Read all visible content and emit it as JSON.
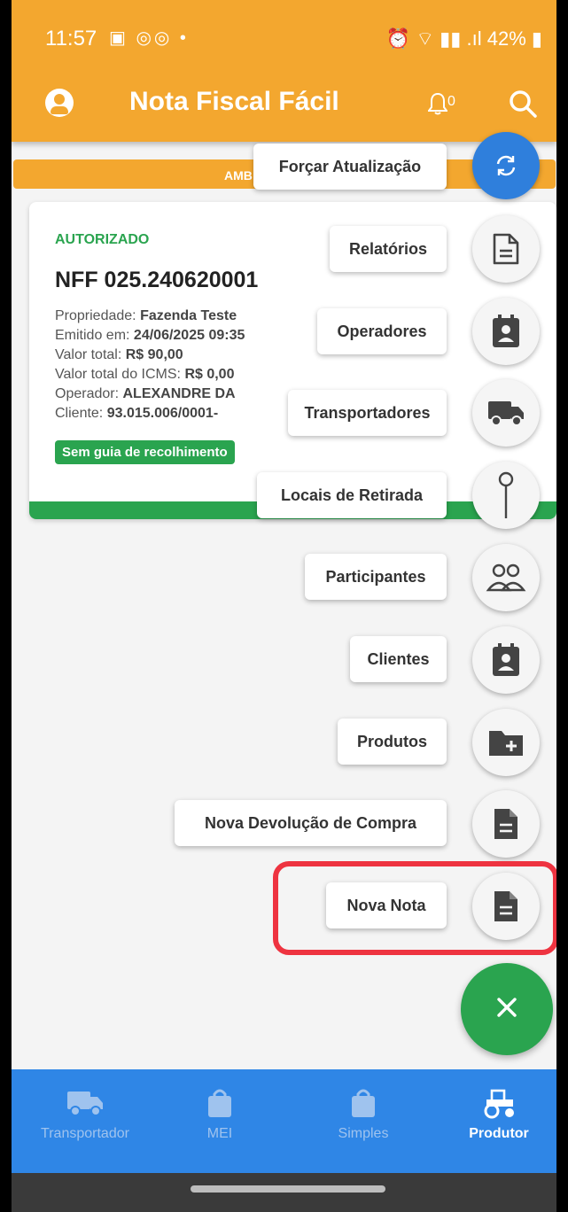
{
  "status_bar": {
    "time": "11:57",
    "left_icons": "▣ ◎◎ •",
    "right_icons": "⏰ ⌔ ▮▮ .ıl",
    "battery": "42%"
  },
  "app_bar": {
    "title": "Nota Fiscal Fácil",
    "notification_count": "0"
  },
  "environment_strip": {
    "text": "AMB"
  },
  "note_card": {
    "status": "AUTORIZADO",
    "number": "NFF 025.240620001",
    "propriedade_label": "Propriedade: ",
    "propriedade_value": "Fazenda Teste",
    "emitido_label": "Emitido em: ",
    "emitido_value": "24/06/2025 09:35",
    "valor_label": "Valor total: ",
    "valor_value": "R$ 90,00",
    "icms_label": "Valor total do ICMS: ",
    "icms_value": "R$ 0,00",
    "operador_label": "Operador: ",
    "operador_value": "ALEXANDRE DA",
    "cliente_label": "Cliente: ",
    "cliente_value": "93.015.006/0001-",
    "badge": "Sem guia de recolhimento"
  },
  "speed_dial": {
    "items": [
      {
        "label": "Forçar Atualização",
        "icon": "refresh-icon"
      },
      {
        "label": "Relatórios",
        "icon": "document-outline-icon"
      },
      {
        "label": "Operadores",
        "icon": "contact-card-icon"
      },
      {
        "label": "Transportadores",
        "icon": "truck-icon"
      },
      {
        "label": "Locais de Retirada",
        "icon": "pin-icon"
      },
      {
        "label": "Participantes",
        "icon": "people-icon"
      },
      {
        "label": "Clientes",
        "icon": "contact-card-icon"
      },
      {
        "label": "Produtos",
        "icon": "folder-plus-icon"
      },
      {
        "label": "Nova Devolução de Compra",
        "icon": "document-icon"
      },
      {
        "label": "Nova Nota",
        "icon": "document-icon"
      }
    ],
    "close_icon": "close-icon"
  },
  "bottom_nav": {
    "items": [
      {
        "label": "Transportador",
        "icon": "truck-icon",
        "active": false
      },
      {
        "label": "MEI",
        "icon": "shopping-bag-icon",
        "active": false
      },
      {
        "label": "Simples",
        "icon": "shopping-bag-icon",
        "active": false
      },
      {
        "label": "Produtor",
        "icon": "tractor-icon",
        "active": true
      }
    ]
  },
  "colors": {
    "brand_orange": "#f3a72f",
    "success_green": "#2aa44f",
    "nav_blue": "#2f86e6",
    "highlight_red": "#ee3340"
  }
}
